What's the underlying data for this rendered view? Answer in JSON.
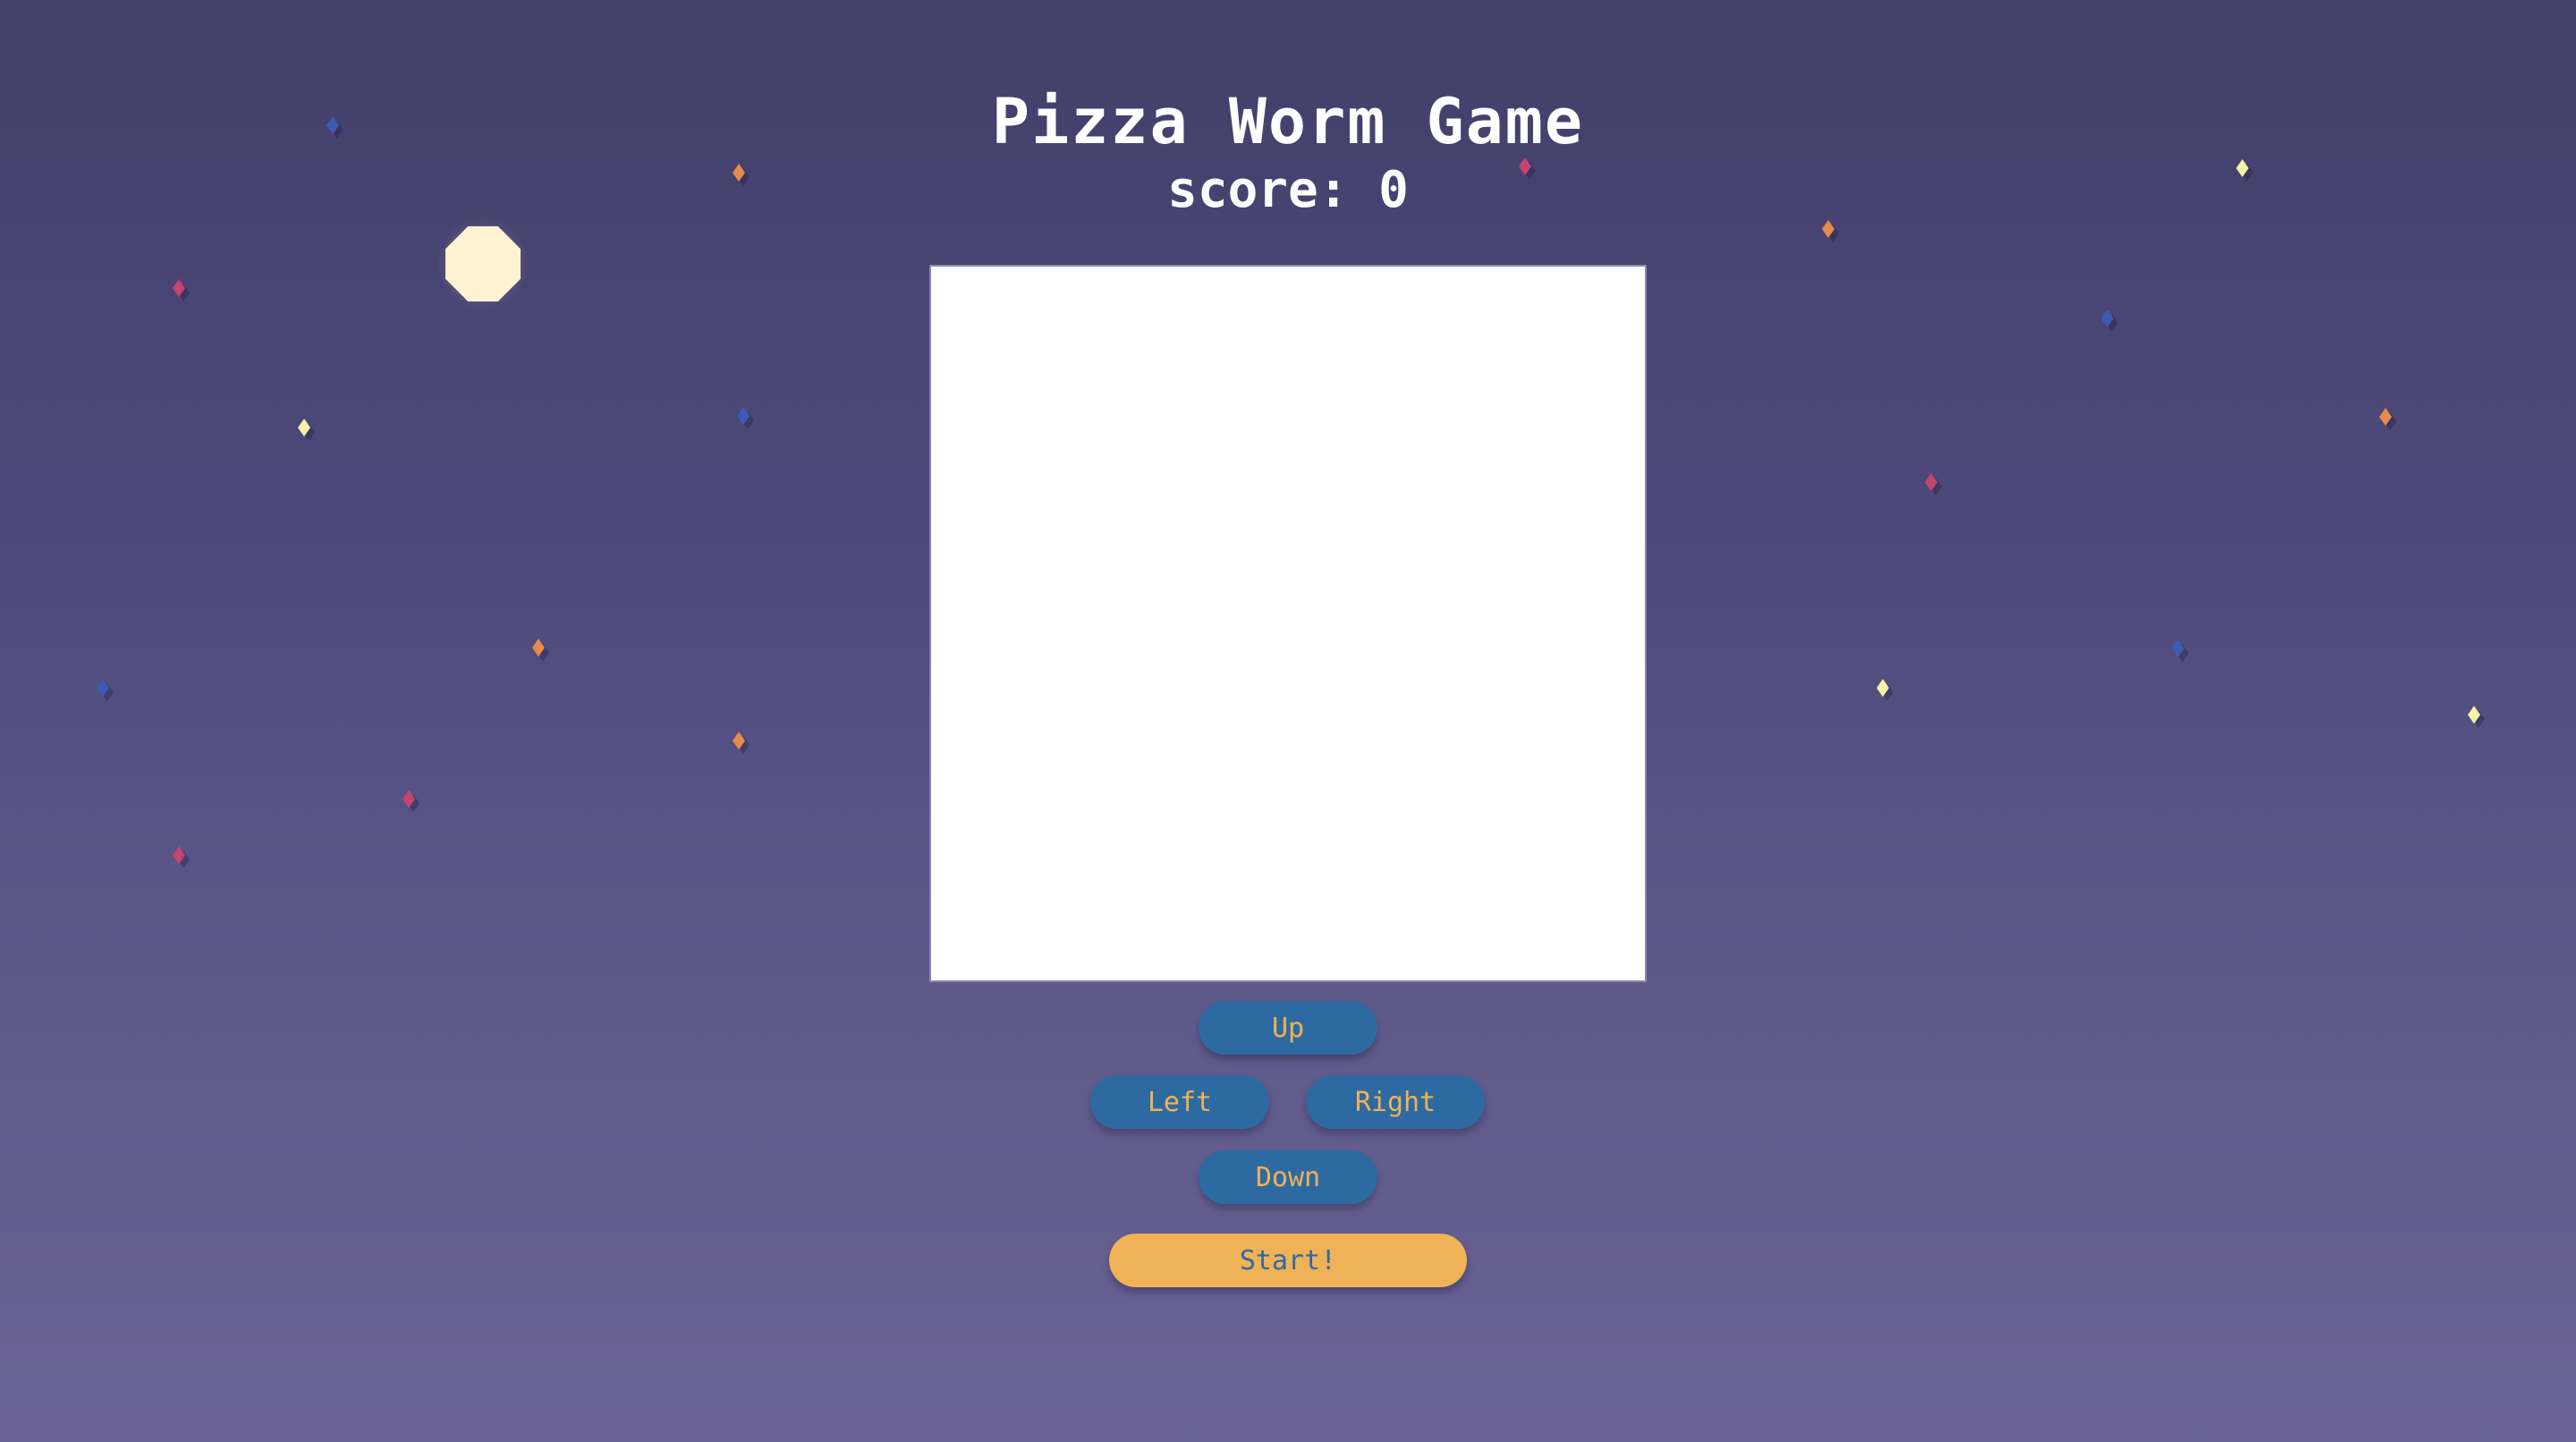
{
  "game": {
    "title": "Pizza Worm Game",
    "score_text": "score: 0"
  },
  "controls": {
    "up_label": "Up",
    "left_label": "Left",
    "right_label": "Right",
    "down_label": "Down",
    "start_label": "Start!"
  },
  "colors": {
    "background_top": "#433f6a",
    "background_bottom": "#6a6395",
    "direction_button_bg": "#2e6aa2",
    "direction_button_text": "#f0b256",
    "start_button_bg": "#f0b256",
    "start_button_text": "#2e6aa2",
    "board_bg": "#ffffff",
    "moon": "#fdf3d3"
  },
  "decor": {
    "moon_icon": "moon-icon",
    "star_icon": "diamond-star-icon",
    "star_colors": [
      "pink",
      "orange",
      "blue",
      "yellow"
    ]
  }
}
